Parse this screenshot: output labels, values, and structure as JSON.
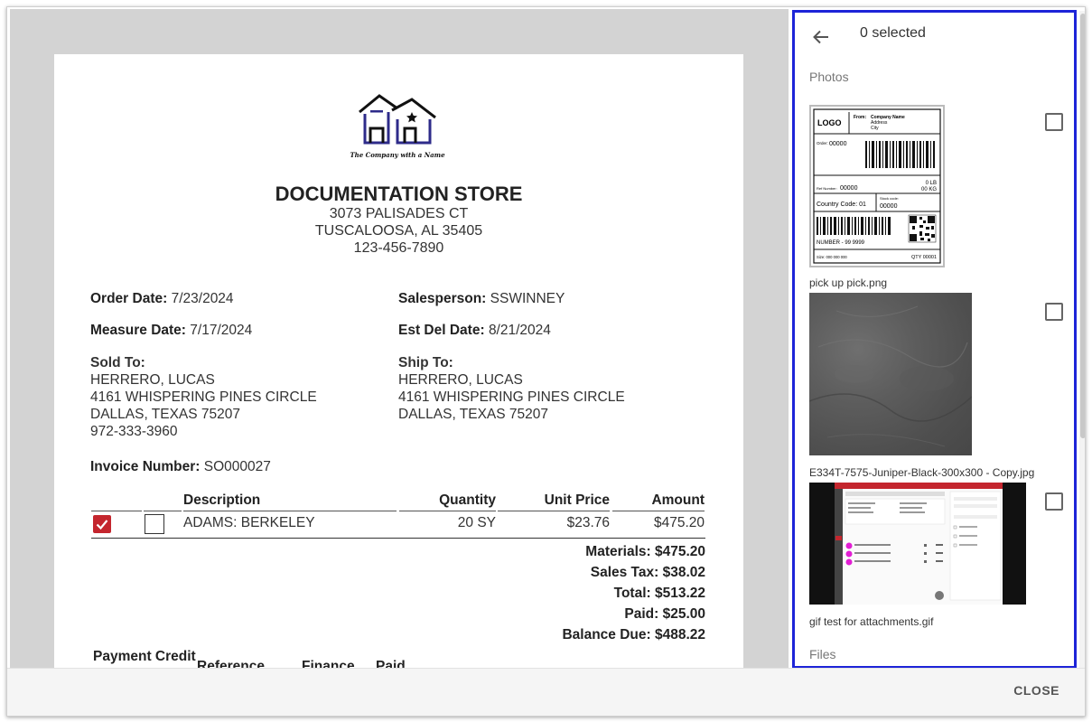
{
  "document": {
    "logo_caption": "The Company with a Name",
    "store_name": "DOCUMENTATION STORE",
    "store_address1": "3073 PALISADES CT",
    "store_address2": "TUSCALOOSA, AL 35405",
    "store_phone": "123-456-7890",
    "order_date_label": "Order Date:",
    "order_date": "7/23/2024",
    "salesperson_label": "Salesperson:",
    "salesperson": "SSWINNEY",
    "measure_date_label": "Measure Date:",
    "measure_date": "7/17/2024",
    "est_del_date_label": "Est Del Date:",
    "est_del_date": "8/21/2024",
    "sold_to_label": "Sold To:",
    "sold_to": {
      "name": "HERRERO, LUCAS",
      "street": "4161 WHISPERING PINES CIRCLE",
      "city": "DALLAS, TEXAS 75207",
      "phone": "972-333-3960"
    },
    "ship_to_label": "Ship To:",
    "ship_to": {
      "name": "HERRERO, LUCAS",
      "street": "4161 WHISPERING PINES CIRCLE",
      "city": "DALLAS, TEXAS 75207"
    },
    "invoice_number_label": "Invoice Number:",
    "invoice_number": "SO000027",
    "table": {
      "headers": {
        "description": "Description",
        "quantity": "Quantity",
        "unit_price": "Unit Price",
        "amount": "Amount"
      },
      "rows": [
        {
          "checked": true,
          "description": "ADAMS: BERKELEY",
          "quantity": "20 SY",
          "unit_price": "$23.76",
          "amount": "$475.20"
        }
      ]
    },
    "totals": {
      "materials": "Materials: $475.20",
      "sales_tax": "Sales Tax: $38.02",
      "total": "Total: $513.22",
      "paid": "Paid: $25.00",
      "balance_due": "Balance Due: $488.22"
    },
    "payments": {
      "headers": {
        "credit": "Payment Credit",
        "reference": "Reference",
        "finance": "Finance",
        "paid": "Paid"
      }
    }
  },
  "panel": {
    "selected_text": "0 selected",
    "photos_label": "Photos",
    "files_label": "Files",
    "photos": [
      {
        "filename": "pick up pick.png"
      },
      {
        "filename": "E334T-7575-Juniper-Black-300x300 - Copy.jpg"
      },
      {
        "filename": "gif test for attachments.gif"
      }
    ],
    "label_thumb": {
      "logo": "LOGO",
      "from": "From:",
      "company": "Company Name",
      "address": "Address",
      "city": "City",
      "order": "Order:",
      "order_no": "00000",
      "ref": "Ref Number:",
      "ref_no": "00000",
      "weight_lb": "0 LB",
      "weight_kg": "00 KG",
      "country": "Country Code: 01",
      "stock": "Stock code:",
      "stock_no": "00000",
      "number": "NUMBER - 99 9999",
      "size": "Size: 000 000 000",
      "qty": "QTY 00001"
    }
  },
  "footer": {
    "close_label": "CLOSE"
  },
  "colors": {
    "panel_border": "#1d24d8",
    "checkbox_red": "#c4262e",
    "preview_bg": "#d3d3d3",
    "logo_blue": "#2e2b8a"
  }
}
